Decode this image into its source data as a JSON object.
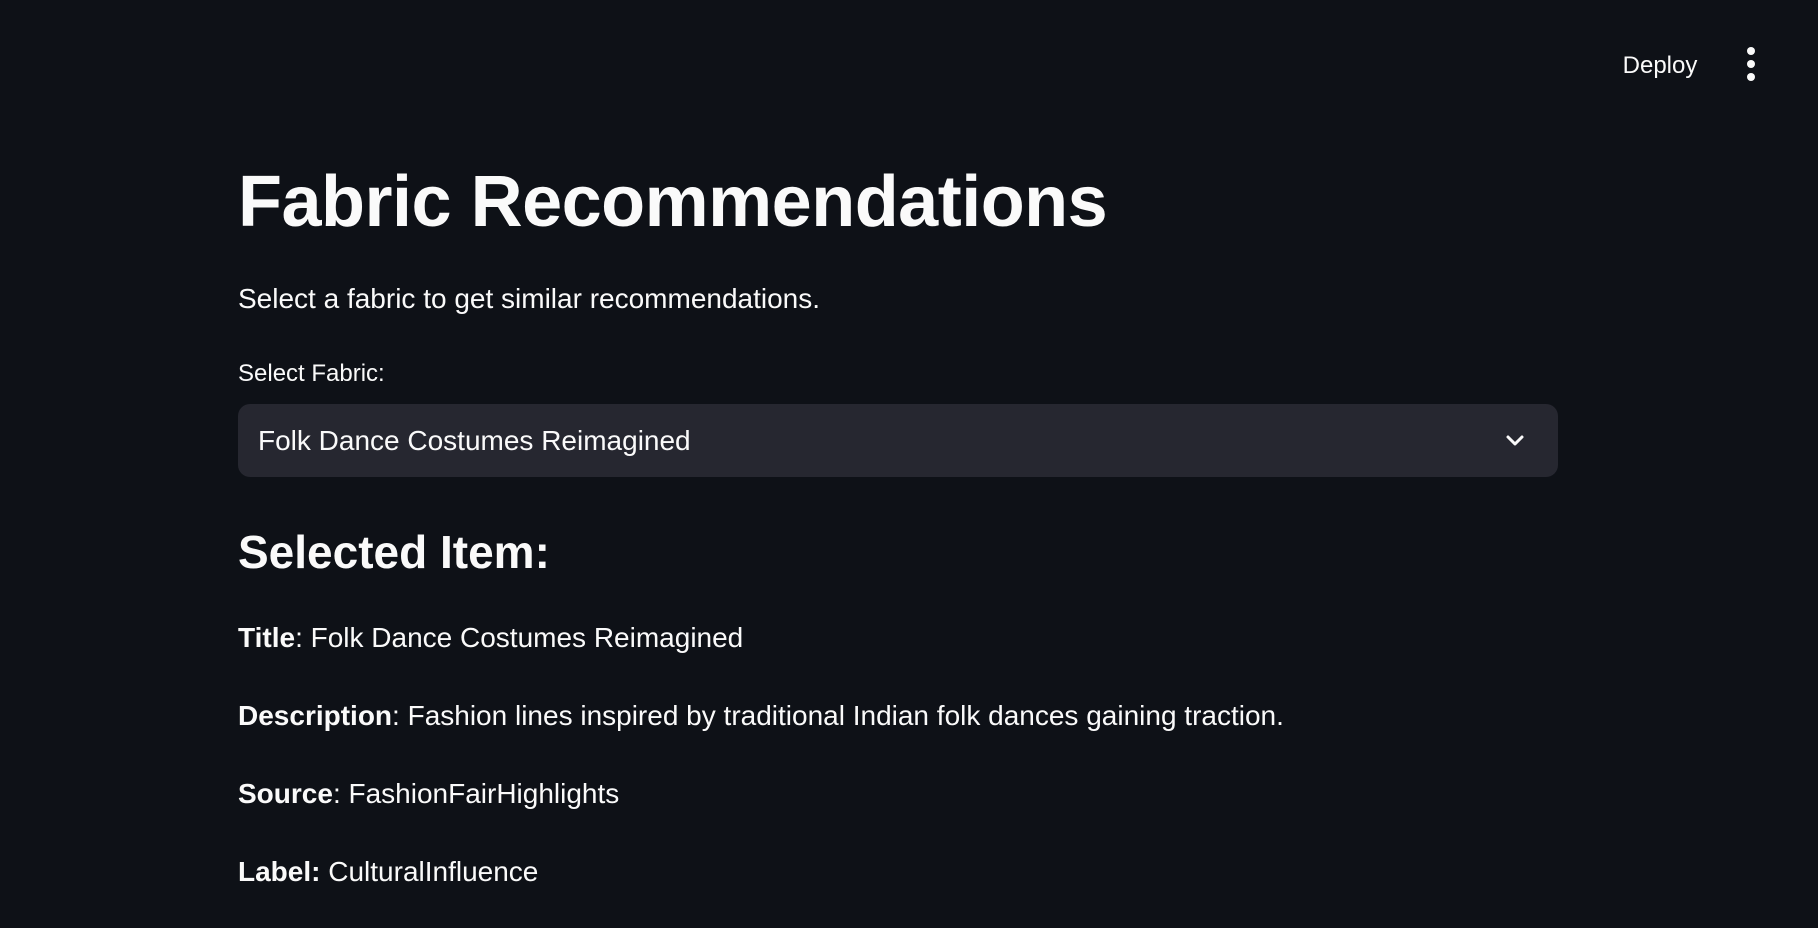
{
  "header": {
    "deploy_label": "Deploy",
    "menu_icon": "vertical-ellipsis-icon"
  },
  "main": {
    "title": "Fabric Recommendations",
    "subtitle": "Select a fabric to get similar recommendations.",
    "select": {
      "label": "Select Fabric:",
      "value": "Folk Dance Costumes Reimagined",
      "icon": "chevron-down-icon"
    },
    "selected_item": {
      "heading": "Selected Item:",
      "title_label": "Title",
      "title_value": ": Folk Dance Costumes Reimagined",
      "description_label": "Description",
      "description_value": ": Fashion lines inspired by traditional Indian folk dances gaining traction.",
      "source_label": "Source",
      "source_value": ": FashionFairHighlights",
      "label_label": "Label:",
      "label_value": " CulturalInfluence"
    }
  },
  "colors": {
    "background": "#0e1117",
    "surface": "#262730",
    "text": "#fafafa"
  }
}
